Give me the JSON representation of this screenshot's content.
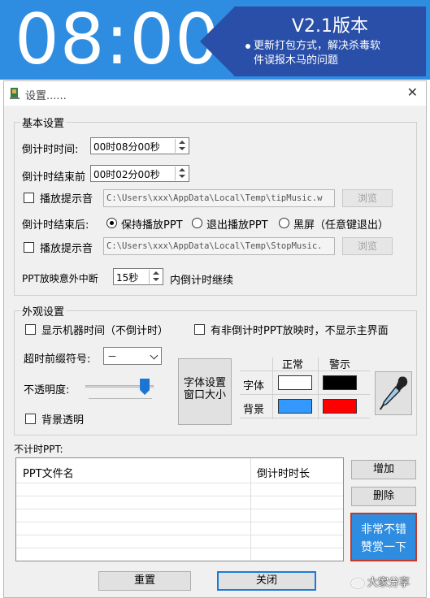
{
  "banner": {
    "clock": "08:00",
    "version_title": "V2.1版本",
    "update_note_line1": "更新打包方式，解决杀毒软",
    "update_note_line2": "件误报木马的问题"
  },
  "window": {
    "title": "设置......",
    "close_glyph": "✕"
  },
  "basic": {
    "group_label": "基本设置",
    "countdown_time_label": "倒计时时间:",
    "countdown_time_value": "00时08分00秒",
    "end_before_label": "倒计时结束前",
    "end_before_value": "00时02分00秒",
    "play_sound1_label": "播放提示音",
    "sound1_path": "C:\\Users\\xxx\\AppData\\Local\\Temp\\tipMusic.w",
    "browse1_label": "浏览",
    "after_end_label": "倒计时结束后:",
    "option_keep": "保持播放PPT",
    "option_exit": "退出播放PPT",
    "option_black": "黑屏（任意键退出）",
    "play_sound2_label": "播放提示音",
    "sound2_path": "C:\\Users\\xxx\\AppData\\Local\\Temp\\StopMusic.",
    "browse2_label": "浏览",
    "interrupt_label": "PPT放映意外中断",
    "interrupt_value": "15秒",
    "interrupt_suffix": "内倒计时继续"
  },
  "appearance": {
    "group_label": "外观设置",
    "show_machine_time": "显示机器时间（不倒计时）",
    "hide_main_ui": "有非倒计时PPT放映时，不显示主界面",
    "prefix_label": "超时前缀符号:",
    "prefix_value": "－",
    "opacity_label": "不透明度:",
    "opacity_level": 0.87,
    "bg_transparent": "背景透明",
    "font_button_line1": "字体设置",
    "font_button_line2": "窗口大小",
    "col_normal": "正常",
    "col_warning": "警示",
    "row_font": "字体",
    "row_bg": "背景",
    "colors": {
      "font_normal": "#ffffff",
      "font_warning": "#000000",
      "bg_normal": "#3399ff",
      "bg_warning": "#ff0000"
    }
  },
  "no_timer": {
    "section_label": "不计时PPT:",
    "col_name": "PPT文件名",
    "col_duration": "倒计时时长",
    "add_button": "增加",
    "delete_button": "删除",
    "reward_line1": "非常不错",
    "reward_line2": "赞赏一下"
  },
  "footer": {
    "reset_button": "重置",
    "close_button": "关闭"
  },
  "watermark": "大家分享"
}
